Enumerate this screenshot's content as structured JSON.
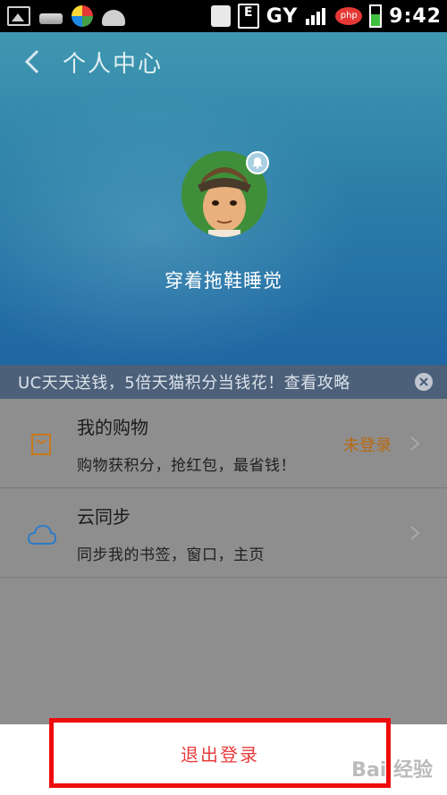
{
  "status_bar": {
    "time": "9:42",
    "network_text": "GY",
    "sim_badge": "E",
    "php_badge": "php",
    "icons": [
      "image-icon",
      "usb-icon",
      "app-icon",
      "android-icon",
      "sound-icon",
      "e-network-icon",
      "signal-icon",
      "php-icon",
      "battery-icon"
    ]
  },
  "header": {
    "title": "个人中心",
    "back_icon": "chevron-left-icon"
  },
  "profile": {
    "username": "穿着拖鞋睡觉",
    "badge_icon": "bell-icon"
  },
  "promo": {
    "text": "UC天天送钱，5倍天猫积分当钱花！查看攻略",
    "close_icon": "close-icon"
  },
  "list": {
    "items": [
      {
        "icon": "shopping-bag-icon",
        "title": "我的购物",
        "subtitle": "购物获积分，抢红包，最省钱！",
        "status": "未登录"
      },
      {
        "icon": "cloud-icon",
        "title": "云同步",
        "subtitle": "同步我的书签，窗口，主页",
        "status": ""
      }
    ]
  },
  "footer": {
    "logout_label": "退出登录",
    "watermark": "Bai 经验"
  },
  "colors": {
    "accent_orange": "#b86a12",
    "logout_red": "#e83c3c",
    "highlight_border": "#ee0b0b",
    "promo_bg": "#4c6079"
  }
}
